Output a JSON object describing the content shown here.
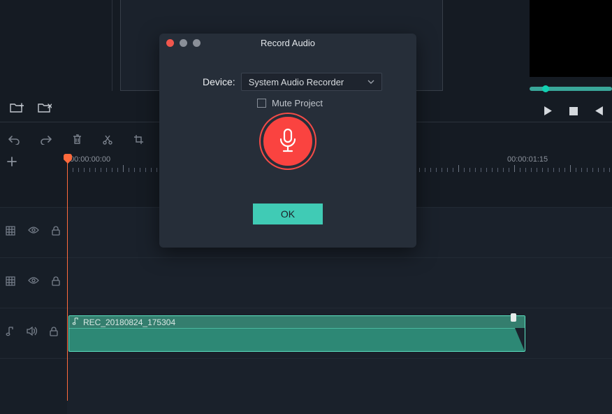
{
  "modal": {
    "title": "Record Audio",
    "device_label": "Device:",
    "device_value": "System Audio Recorder",
    "mute_label": "Mute Project",
    "mute_checked": false,
    "ok_label": "OK"
  },
  "timeline": {
    "ruler": {
      "t0": "00:00:00:00",
      "t1": "00:00:01:15"
    },
    "playhead_time": "00:00:00:00",
    "tracks": {
      "video1": {},
      "video2": {},
      "audio1": {
        "clip_name": "REC_20180824_175304"
      }
    }
  },
  "colors": {
    "accent": "#40cbb5",
    "record": "#fa4340",
    "playhead": "#ff6a3c"
  }
}
